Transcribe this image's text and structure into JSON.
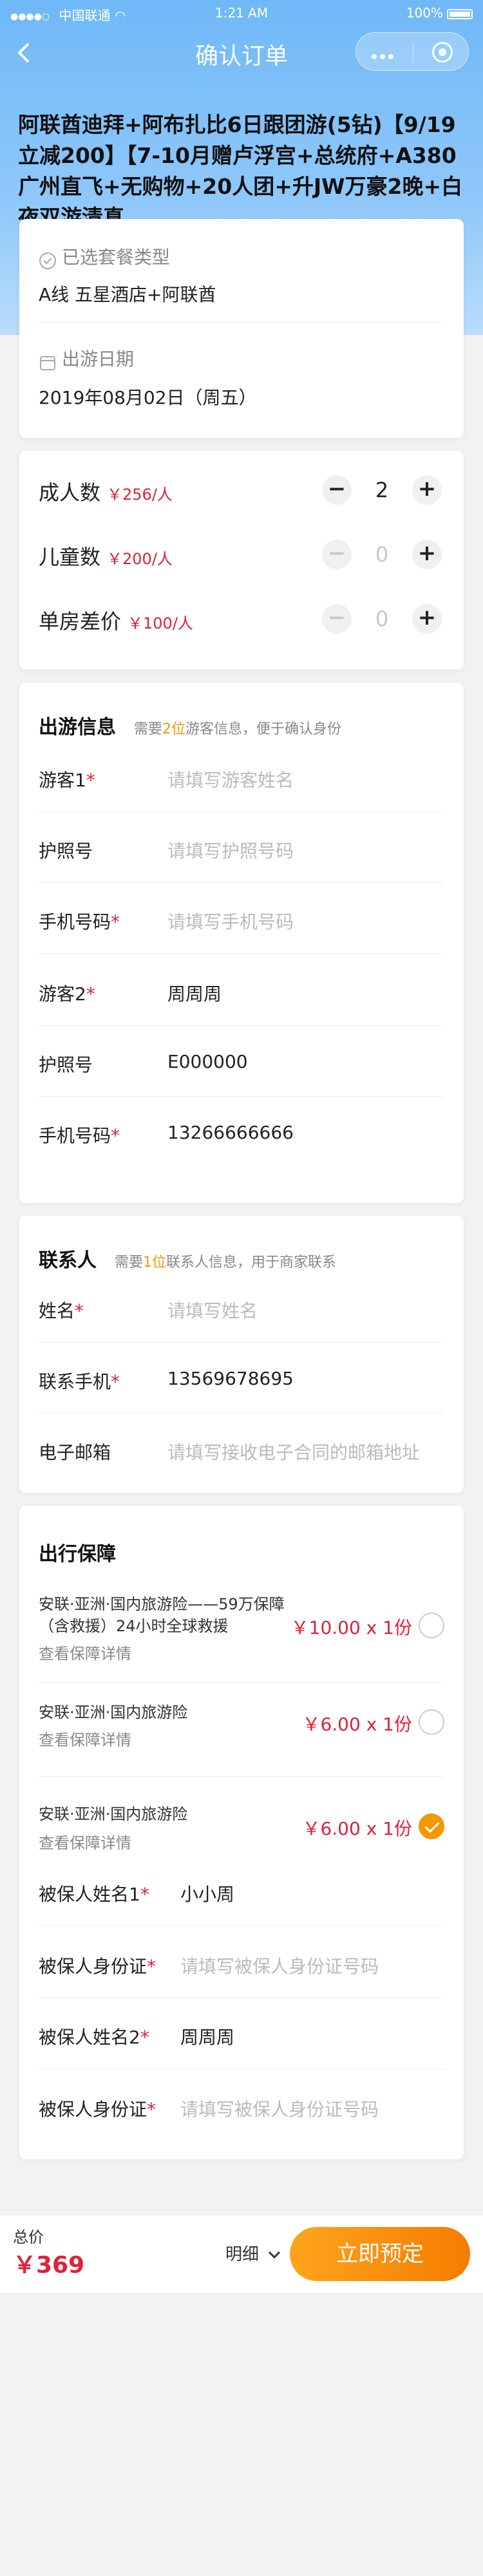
{
  "status_bar": {
    "carrier": "中国联通",
    "time": "1:21 AM",
    "battery": "100%"
  },
  "nav": {
    "title": "确认订单"
  },
  "product_title": "阿联酋迪拜+阿布扎比6日跟团游(5钻)【9/19立减200】【7-10月赠卢浮宫+总统府+A380广州直飞+无购物+20人团+升JW万豪2晚+白夜双游清真",
  "package": {
    "label": "已选套餐类型",
    "value": "A线 五星酒店+阿联酋"
  },
  "date": {
    "label": "出游日期",
    "value": "2019年08月02日（周五）"
  },
  "counts": [
    {
      "label": "成人数",
      "price": "￥256/人",
      "value": "2",
      "minus_enabled": true
    },
    {
      "label": "儿童数",
      "price": "￥200/人",
      "value": "0",
      "minus_enabled": false
    },
    {
      "label": "单房差价",
      "price": "￥100/人",
      "value": "0",
      "minus_enabled": false
    }
  ],
  "travelers": {
    "title": "出游信息",
    "hint_pre": "需要",
    "hint_num": "2位",
    "hint_post": "游客信息，便于确认身份",
    "fields": [
      {
        "label": "游客1",
        "required": "*",
        "value": "",
        "placeholder": "请填写游客姓名"
      },
      {
        "label": "护照号",
        "required": "",
        "value": "",
        "placeholder": "请填写护照号码"
      },
      {
        "label": "手机号码",
        "required": "*",
        "value": "",
        "placeholder": "请填写手机号码"
      },
      {
        "label": "游客2",
        "required": "*",
        "value": "周周周",
        "placeholder": ""
      },
      {
        "label": "护照号",
        "required": "",
        "value": "E000000",
        "placeholder": ""
      },
      {
        "label": "手机号码",
        "required": "*",
        "value": "13266666666",
        "placeholder": ""
      }
    ]
  },
  "contact": {
    "title": "联系人",
    "hint_pre": "需要",
    "hint_num": "1位",
    "hint_post": "联系人信息，用于商家联系",
    "fields": [
      {
        "label": "姓名",
        "required": "*",
        "value": "",
        "placeholder": "请填写姓名"
      },
      {
        "label": "联系手机",
        "required": "*",
        "value": "13569678695",
        "placeholder": ""
      },
      {
        "label": "电子邮箱",
        "required": "",
        "value": "",
        "placeholder": "请填写接收电子合同的邮箱地址"
      }
    ]
  },
  "insurance": {
    "title": "出行保障",
    "items": [
      {
        "name": "安联·亚洲·国内旅游险——59万保障（含救援）24小时全球救援",
        "link": "查看保障详情",
        "price": "￥10.00 x 1份",
        "selected": false
      },
      {
        "name": "安联·亚洲·国内旅游险",
        "link": "查看保障详情",
        "price": "￥6.00 x 1份",
        "selected": false
      },
      {
        "name": "安联·亚洲·国内旅游险",
        "link": "查看保障详情",
        "price": "￥6.00 x 1份",
        "selected": true
      }
    ],
    "insured": [
      {
        "label": "被保人姓名1",
        "required": "*",
        "value": "小小周",
        "placeholder": ""
      },
      {
        "label": "被保人身份证",
        "required": "*",
        "value": "",
        "placeholder": "请填写被保人身份证号码"
      },
      {
        "label": "被保人姓名2",
        "required": "*",
        "value": "周周周",
        "placeholder": ""
      },
      {
        "label": "被保人身份证",
        "required": "*",
        "value": "",
        "placeholder": "请填写被保人身份证号码"
      }
    ]
  },
  "bottom": {
    "total_label": "总价",
    "total_value": "￥369",
    "detail_label": "明细",
    "book_label": "立即预定"
  },
  "colors": {
    "accent": "#f39800",
    "price": "#e0203a",
    "header": "#6fb8f7"
  }
}
